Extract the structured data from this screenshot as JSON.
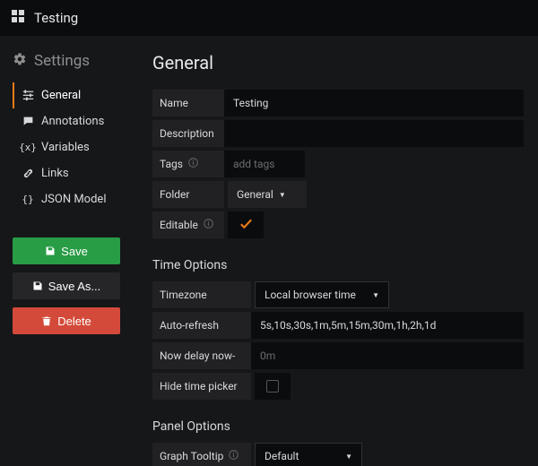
{
  "topbar": {
    "title": "Testing"
  },
  "sidebar": {
    "title": "Settings",
    "items": [
      {
        "label": "General"
      },
      {
        "label": "Annotations"
      },
      {
        "label": "Variables"
      },
      {
        "label": "Links"
      },
      {
        "label": "JSON Model"
      }
    ],
    "actions": {
      "save": "Save",
      "save_as": "Save As...",
      "delete": "Delete"
    }
  },
  "main": {
    "heading": "General",
    "general": {
      "name_label": "Name",
      "name_value": "Testing",
      "description_label": "Description",
      "description_value": "",
      "tags_label": "Tags",
      "tags_placeholder": "add tags",
      "folder_label": "Folder",
      "folder_value": "General",
      "editable_label": "Editable",
      "editable_checked": true
    },
    "time": {
      "section": "Time Options",
      "timezone_label": "Timezone",
      "timezone_value": "Local browser time",
      "autorefresh_label": "Auto-refresh",
      "autorefresh_value": "5s,10s,30s,1m,5m,15m,30m,1h,2h,1d",
      "nowdelay_label": "Now delay now-",
      "nowdelay_placeholder": "0m",
      "hidepicker_label": "Hide time picker",
      "hidepicker_checked": false
    },
    "panel": {
      "section": "Panel Options",
      "tooltip_label": "Graph Tooltip",
      "tooltip_value": "Default"
    }
  }
}
